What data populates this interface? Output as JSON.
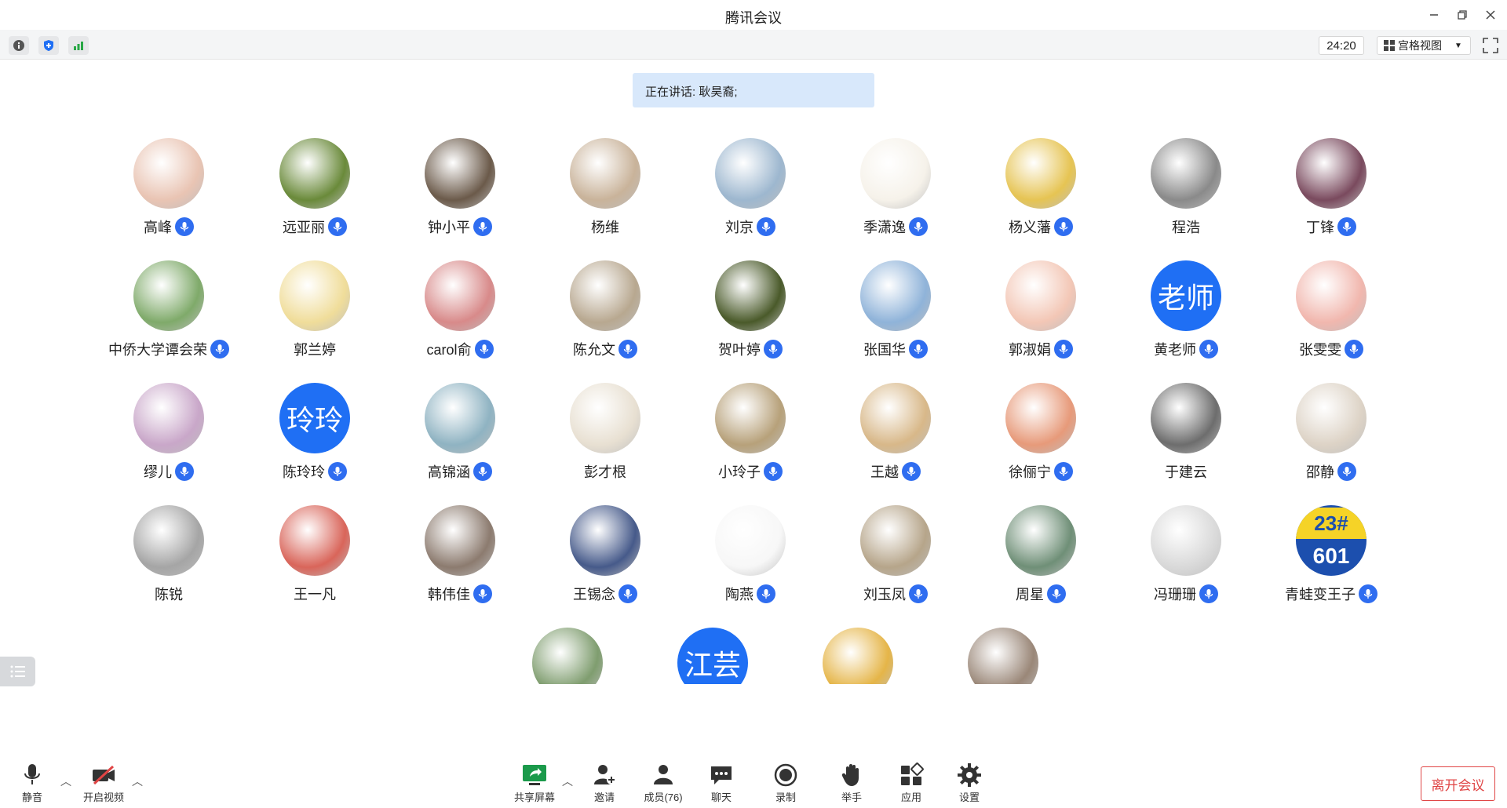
{
  "app": {
    "title": "腾讯会议"
  },
  "toolbar": {
    "timer": "24:20",
    "view_label": "宫格视图"
  },
  "banner": {
    "speaking": "正在讲话: 耿昊裔;"
  },
  "participants": [
    {
      "name": "高峰",
      "mic": true,
      "bg": "#e9c4b3"
    },
    {
      "name": "远亚丽",
      "mic": true,
      "bg": "#6a8a3a"
    },
    {
      "name": "钟小平",
      "mic": true,
      "bg": "#6b5a4a"
    },
    {
      "name": "杨维",
      "mic": false,
      "bg": "#c9b39a"
    },
    {
      "name": "刘京",
      "mic": true,
      "bg": "#9db7cf"
    },
    {
      "name": "季潇逸",
      "mic": true,
      "bg": "#f6f2ea"
    },
    {
      "name": "杨义藩",
      "mic": true,
      "bg": "#e6c453"
    },
    {
      "name": "程浩",
      "mic": false,
      "bg": "#8a8a8a"
    },
    {
      "name": "丁锋",
      "mic": true,
      "bg": "#7a4a5e"
    },
    {
      "name": "中侨大学谭会荣",
      "mic": true,
      "bg": "#7faa6a"
    },
    {
      "name": "郭兰婷",
      "mic": false,
      "bg": "#f0dd9a"
    },
    {
      "name": "carol俞",
      "mic": true,
      "bg": "#d88a8a"
    },
    {
      "name": "陈允文",
      "mic": true,
      "bg": "#b8a890"
    },
    {
      "name": "贺叶婷",
      "mic": true,
      "bg": "#4a5a2a"
    },
    {
      "name": "张国华",
      "mic": true,
      "bg": "#8fb3d9"
    },
    {
      "name": "郭淑娟",
      "mic": true,
      "bg": "#f3c7b6"
    },
    {
      "name": "黄老师",
      "mic": true,
      "text": "老师"
    },
    {
      "name": "张雯雯",
      "mic": true,
      "bg": "#f1b7ae"
    },
    {
      "name": "缪儿",
      "mic": true,
      "bg": "#c9a7c9"
    },
    {
      "name": "陈玲玲",
      "mic": true,
      "text": "玲玲"
    },
    {
      "name": "高锦涵",
      "mic": true,
      "bg": "#8fb3c2"
    },
    {
      "name": "彭才根",
      "mic": false,
      "bg": "#e8e0d2"
    },
    {
      "name": "小玲子",
      "mic": true,
      "bg": "#b7a17a"
    },
    {
      "name": "王越",
      "mic": true,
      "bg": "#d8b889"
    },
    {
      "name": "徐俪宁",
      "mic": true,
      "bg": "#e79a7a"
    },
    {
      "name": "于建云",
      "mic": false,
      "bg": "#6d6d6d"
    },
    {
      "name": "邵静",
      "mic": true,
      "bg": "#ddd3c6"
    },
    {
      "name": "陈锐",
      "mic": false,
      "bg": "#a5a5a5"
    },
    {
      "name": "王一凡",
      "mic": false,
      "bg": "#d9655a"
    },
    {
      "name": "韩伟佳",
      "mic": true,
      "bg": "#8c7b6f"
    },
    {
      "name": "王锡念",
      "mic": true,
      "bg": "#465a8a"
    },
    {
      "name": "陶燕",
      "mic": true,
      "bg": "#f7f7f7"
    },
    {
      "name": "刘玉凤",
      "mic": true,
      "bg": "#b6a58a"
    },
    {
      "name": "周星",
      "mic": true,
      "bg": "#6f8f77"
    },
    {
      "name": "冯珊珊",
      "mic": true,
      "bg": "#d9d9d9"
    },
    {
      "name": "青蛙变王子",
      "mic": true,
      "bg": "#1c4fae",
      "badge": "23# 601"
    },
    {
      "name": "",
      "mic": false,
      "bg": "#7f9d6f"
    },
    {
      "name": "",
      "mic": false,
      "text": "江芸"
    },
    {
      "name": "",
      "mic": false,
      "bg": "#e5b548"
    },
    {
      "name": "",
      "mic": false,
      "bg": "#9a8778"
    }
  ],
  "bottom": {
    "mute": "静音",
    "video": "开启视频",
    "share": "共享屏幕",
    "invite": "邀请",
    "members": "成员(76)",
    "chat": "聊天",
    "record": "录制",
    "raise_hand": "举手",
    "apps": "应用",
    "settings": "设置",
    "leave": "离开会议"
  },
  "colors": {
    "accent": "#1f6ff4",
    "danger": "#e04545",
    "banner": "#d8e8fb"
  }
}
